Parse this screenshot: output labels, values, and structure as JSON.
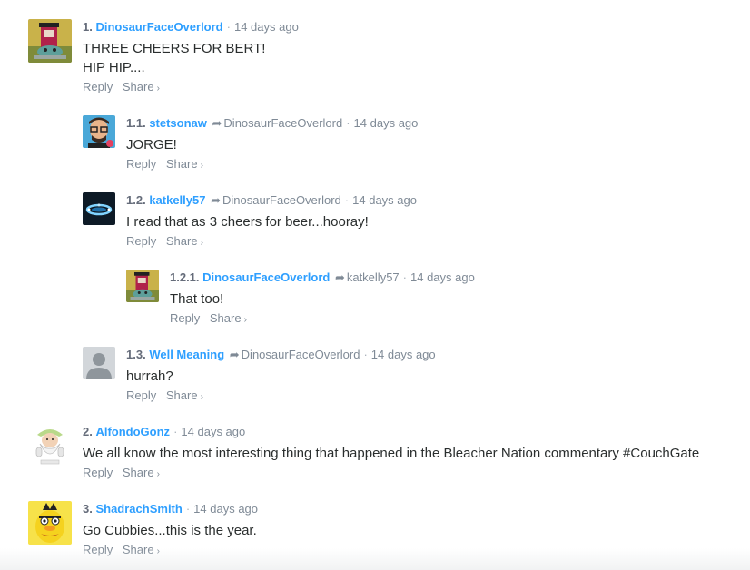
{
  "comments": [
    {
      "number": "1.",
      "author": "DinosaurFaceOverlord",
      "parent": "",
      "time": "14 days ago",
      "lines": [
        "THREE CHEERS FOR BERT!",
        "HIP HIP...."
      ],
      "avatar": "dinosaur-avatar"
    },
    {
      "number": "1.1.",
      "author": "stetsonaw",
      "parent": "DinosaurFaceOverlord",
      "time": "14 days ago",
      "lines": [
        "JORGE!"
      ],
      "avatar": "glasses-man-avatar"
    },
    {
      "number": "1.2.",
      "author": "katkelly57",
      "parent": "DinosaurFaceOverlord",
      "time": "14 days ago",
      "lines": [
        "I read that as 3 cheers for beer...hooray!"
      ],
      "avatar": "blue-lights-avatar"
    },
    {
      "number": "1.2.1.",
      "author": "DinosaurFaceOverlord",
      "parent": "katkelly57",
      "time": "14 days ago",
      "lines": [
        "That too!"
      ],
      "avatar": "dinosaur-avatar"
    },
    {
      "number": "1.3.",
      "author": "Well Meaning",
      "parent": "DinosaurFaceOverlord",
      "time": "14 days ago",
      "lines": [
        "hurrah?"
      ],
      "avatar": "default-user-avatar"
    },
    {
      "number": "2.",
      "author": "AlfondoGonz",
      "parent": "",
      "time": "14 days ago",
      "lines": [
        "We all know the most interesting thing that happened in the Bleacher Nation commentary #CouchGate"
      ],
      "avatar": "sage-cartoon-avatar"
    },
    {
      "number": "3.",
      "author": "ShadrachSmith",
      "parent": "",
      "time": "14 days ago",
      "lines": [
        "Go Cubbies...this is the year."
      ],
      "avatar": "bert-avatar"
    }
  ],
  "actions": {
    "reply": "Reply",
    "share": "Share",
    "share_chevron": "›"
  },
  "glyphs": {
    "reply_arrow": "➦",
    "separator": "·"
  },
  "colors": {
    "author": "#2e9fff",
    "meta": "#7f8a96",
    "text": "#2a2e2e"
  }
}
